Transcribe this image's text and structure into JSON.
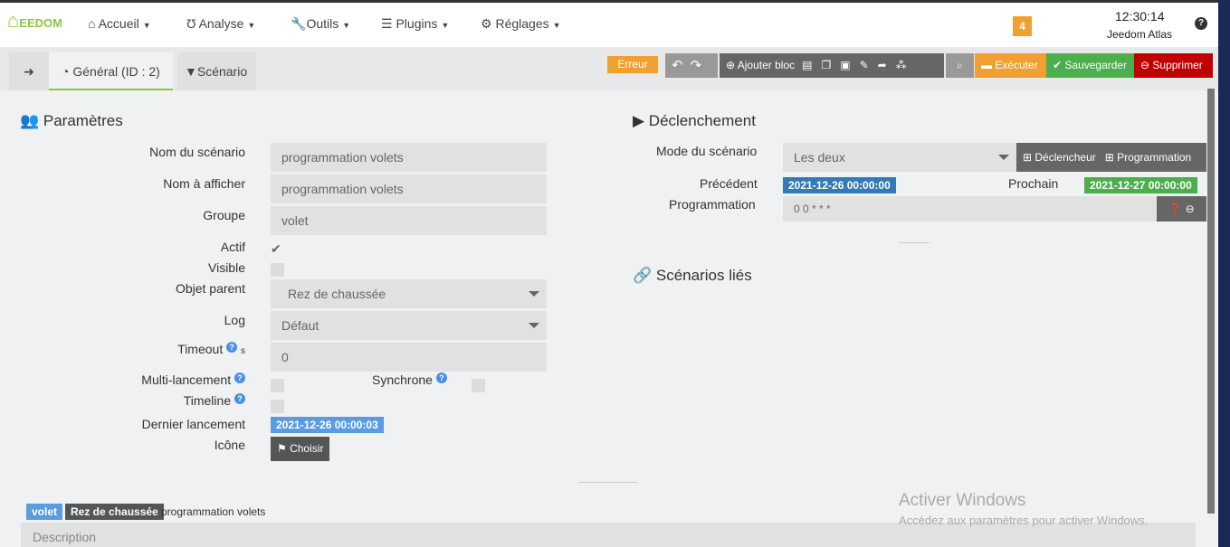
{
  "header": {
    "logo": "EEDOM",
    "nav": [
      {
        "icon": "home-icon",
        "label": "Accueil"
      },
      {
        "icon": "stethoscope-icon",
        "label": "Analyse"
      },
      {
        "icon": "wrench-icon",
        "label": "Outils"
      },
      {
        "icon": "list-icon",
        "label": "Plugins"
      },
      {
        "icon": "gear-icon",
        "label": "Réglages"
      }
    ],
    "notif_count": "4",
    "time": "12:30:14",
    "system_name": "Jeedom Atlas"
  },
  "tabs": [
    {
      "label": "Général (ID : 2)",
      "active": true
    },
    {
      "label": "Scénario"
    }
  ],
  "toolbar": {
    "status": "Erreur",
    "add_block": "Ajouter bloc",
    "execute": "Exécuter",
    "save": "Sauvegarder",
    "delete": "Supprimer"
  },
  "params": {
    "title": "Paramètres",
    "name_label": "Nom du scénario",
    "name": "programmation volets",
    "display_label": "Nom à afficher",
    "display": "programmation volets",
    "group_label": "Groupe",
    "group": "volet",
    "active_label": "Actif",
    "active": true,
    "visible_label": "Visible",
    "visible": false,
    "parent_label": "Objet parent",
    "parent": "Rez de chaussée",
    "log_label": "Log",
    "log": "Défaut",
    "timeout_label": "Timeout",
    "timeout_unit": "s",
    "timeout": "0",
    "multi_label": "Multi-lancement",
    "sync_label": "Synchrone",
    "timeline_label": "Timeline",
    "last_label": "Dernier lancement",
    "last": "2021-12-26 00:00:03",
    "icon_label": "Icône",
    "choose": "Choisir"
  },
  "trigger": {
    "title": "Déclenchement",
    "mode_label": "Mode du scénario",
    "mode": "Les deux",
    "add_trigger": "Déclencheur",
    "add_schedule": "Programmation",
    "prev_label": "Précédent",
    "prev": "2021-12-26 00:00:00",
    "next_label": "Prochain",
    "next": "2021-12-27 00:00:00",
    "schedule_label": "Programmation",
    "schedule": "0 0 * * *"
  },
  "linked": {
    "title": "Scénarios liés"
  },
  "footer": {
    "tag_group": "volet",
    "tag_parent": "Rez de chaussée",
    "tag_name": "programmation volets",
    "description_placeholder": "Description"
  },
  "watermark": {
    "title": "Activer Windows",
    "subtitle": "Accédez aux paramètres pour activer Windows."
  },
  "colors": {
    "green": "#8cc63f",
    "orange": "#f0a030",
    "save": "#4cae4c",
    "delete": "#c00000",
    "blue": "#337ab7"
  }
}
